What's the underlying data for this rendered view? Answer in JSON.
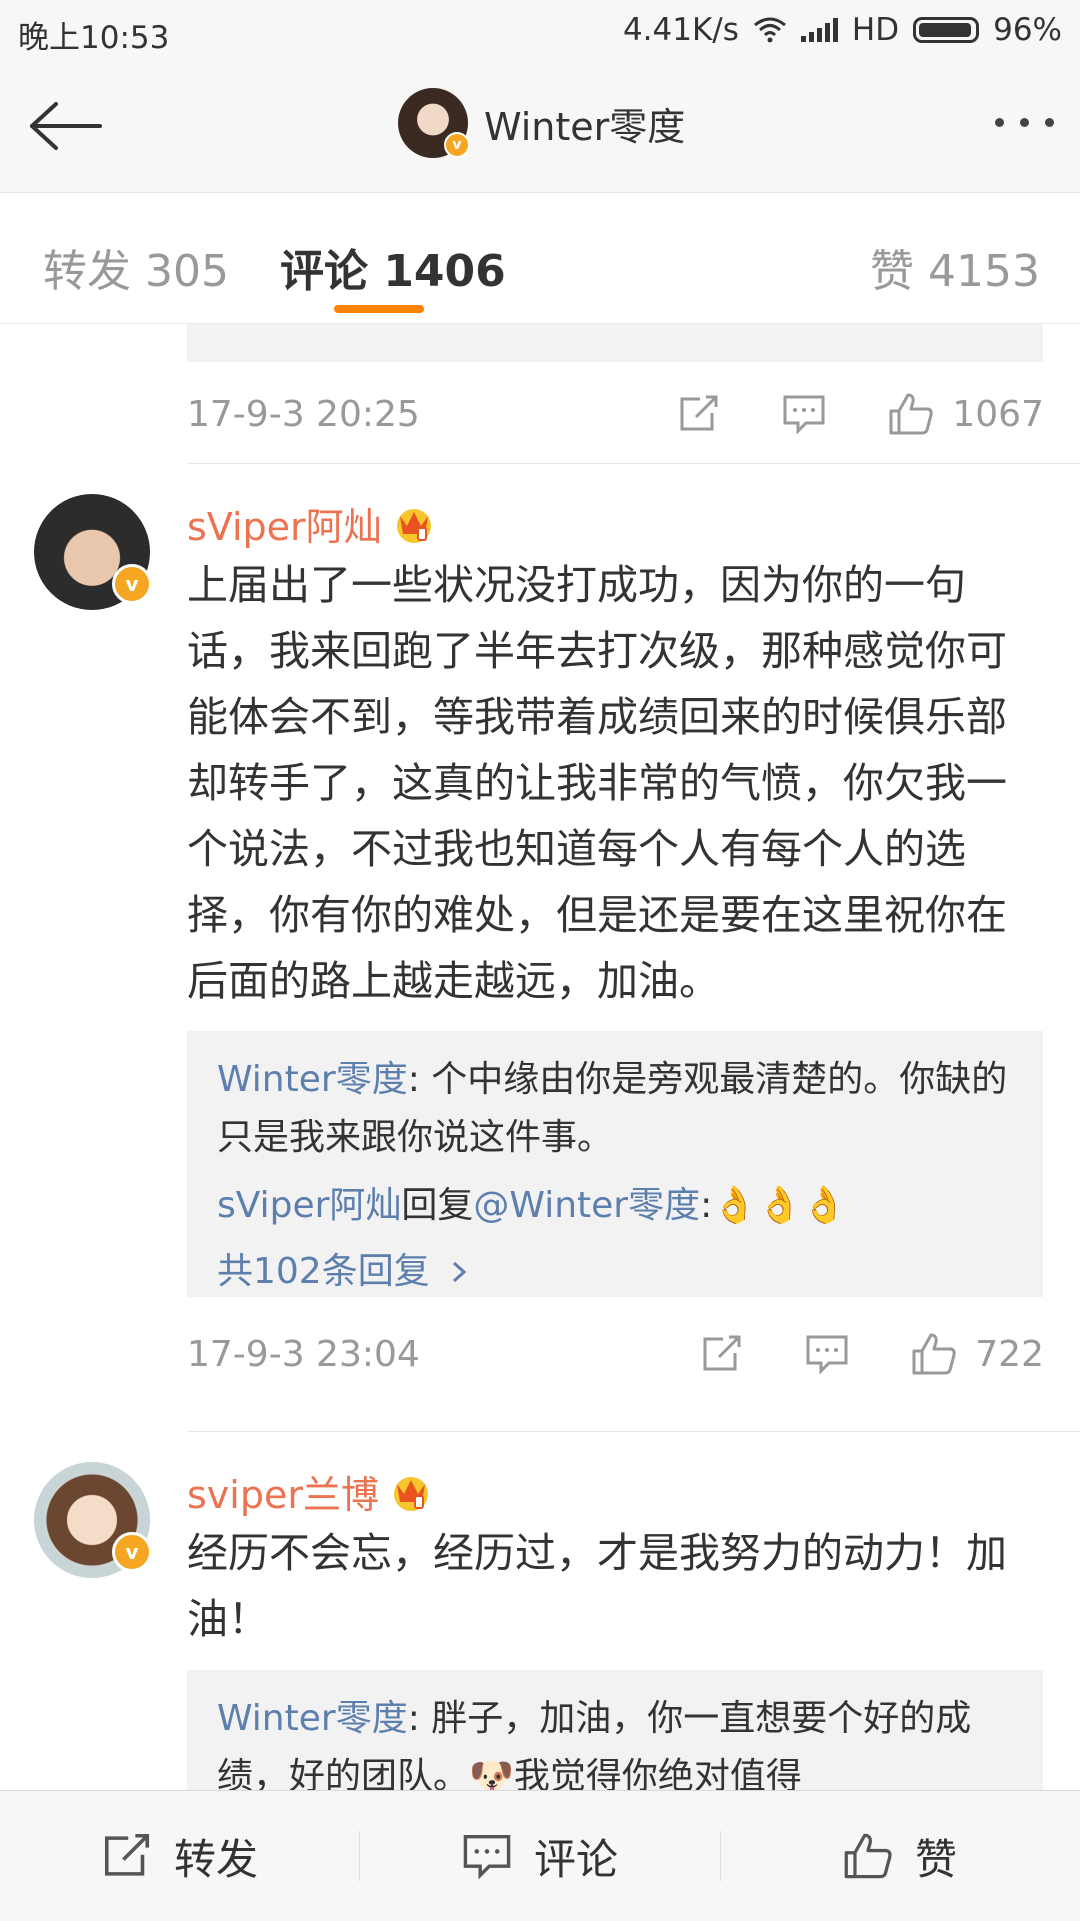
{
  "status_bar": {
    "time": "晚上10:53",
    "speed": "4.41K/s",
    "network": "HD",
    "battery": "96%"
  },
  "nav": {
    "title": "Winter零度",
    "avatar_badge": "v"
  },
  "tabs": {
    "repost": "转发 305",
    "comments": "评论 1406",
    "likes": "赞 4153"
  },
  "first_comment_meta": {
    "date": "17-9-3 20:25",
    "likes": "1067"
  },
  "comments": [
    {
      "username": "sViper阿灿",
      "text": "上届出了一些状况没打成功，因为你的一句话，我来回跑了半年去打次级，那种感觉你可能体会不到，等我带着成绩回来的时候俱乐部却转手了，这真的让我非常的气愤，你欠我一个说法，不过我也知道每个人有每个人的选择，你有你的难处，但是还是要在这里祝你在后面的路上越走越远，加油。",
      "reply1_user": "Winter零度",
      "reply1_text": ": 个中缘由你是旁观最清楚的。你缺的只是我来跟你说这件事。",
      "reply2_user": "sViper阿灿",
      "reply2_mid": "回复",
      "reply2_target": "@Winter零度",
      "reply2_colon": ":",
      "reply2_emoji": "👌👌👌",
      "more_replies": "共102条回复",
      "date": "17-9-3 23:04",
      "likes": "722"
    },
    {
      "username": "sviper兰博",
      "text": "经历不会忘，经历过，才是我努力的动力！加油！",
      "reply1_user": "Winter零度",
      "reply1_text": ": 胖子，加油，你一直想要个好的成绩，好的团队。",
      "reply1_emoji": "🐶",
      "reply1_tail": "我觉得你绝对值得"
    }
  ],
  "bottom_bar": {
    "repost": "转发",
    "comment": "评论",
    "like": "赞"
  },
  "colors": {
    "accent": "#ff8200",
    "username": "#eb7350",
    "link": "#5d7fae",
    "badge": "#f5a623"
  }
}
